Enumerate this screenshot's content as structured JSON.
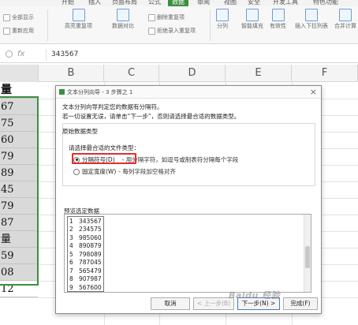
{
  "ribbon": {
    "tabs": [
      "开始",
      "插入",
      "页面布局",
      "公式",
      "数据",
      "审阅",
      "视图",
      "安全",
      "开发工具",
      "特色功能"
    ],
    "active_tab": 4,
    "buttons": {
      "show_all": "全部显示",
      "reapply": "重新应用",
      "highlight_dup": "高亮重复项",
      "data_compare": "数据对比",
      "reject_dup": "拒绝录入重复项",
      "delete_dup": "删除重复项",
      "split": "分列",
      "smart_fill": "智能填充",
      "validity": "有效性",
      "insert_dropdown": "插入下拉列表",
      "merge_calc": "合并计算"
    }
  },
  "formula_bar": {
    "fx": "fx",
    "value": "343567"
  },
  "grid": {
    "columns": [
      "B",
      "C",
      "D",
      "E",
      "F"
    ],
    "col_a_cells": [
      "量",
      "67",
      "75",
      "60",
      "79",
      "89",
      "45",
      "79",
      "87",
      "量",
      "59",
      "08",
      "12"
    ]
  },
  "dialog": {
    "title": "文本分列向导 - 3 步骤之 1",
    "close": "×",
    "intro_line1": "文本分列向导判定您的数据有分隔符。",
    "intro_line2": "若一切设置无误，请单击“下一步”，否则请选择最合适的数据类型。",
    "group_label": "原始数据类型",
    "sub_label": "请选择最合适的文件类型：",
    "option_delimited": "分隔符号(D)",
    "option_delimited_desc": "- 用分隔字符，如逗号或制表符分隔每个字段",
    "option_fixed": "固定宽度(W)",
    "option_fixed_desc": "- 每列字段加空格对齐",
    "preview_label": "预览选定数据",
    "preview_rows": [
      {
        "n": "1",
        "v": "343567"
      },
      {
        "n": "2",
        "v": "234575"
      },
      {
        "n": "3",
        "v": "985060"
      },
      {
        "n": "4",
        "v": "890879"
      },
      {
        "n": "5",
        "v": "798089"
      },
      {
        "n": "6",
        "v": "787045"
      },
      {
        "n": "7",
        "v": "565479"
      },
      {
        "n": "8",
        "v": "907987"
      },
      {
        "n": "9",
        "v": "567600"
      }
    ],
    "btn_cancel": "取消",
    "btn_back": "< 上一步(B)",
    "btn_next": "下一步(N) >",
    "btn_finish": "完成(F)"
  },
  "watermark": "Baidu 经验",
  "colors": {
    "accent": "#3b8f3e",
    "highlight_box": "#e0302a",
    "selected_cell_bg": "#d9d9d9"
  }
}
